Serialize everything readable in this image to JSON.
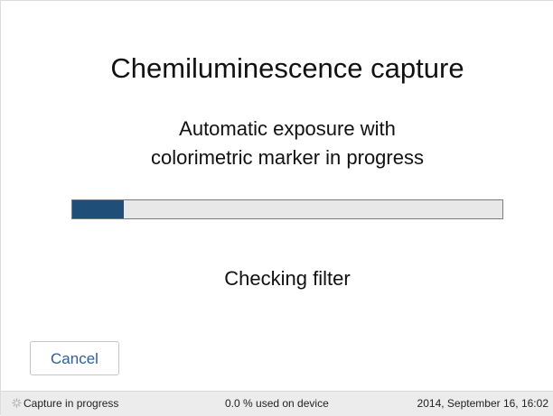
{
  "dialog": {
    "title": "Chemiluminescence capture",
    "subtitle_line1": "Automatic exposure with",
    "subtitle_line2": "colorimetric marker in progress",
    "progress_fraction": 0.12,
    "progress_color": "#1f4e79",
    "status": "Checking filter",
    "cancel_label": "Cancel"
  },
  "statusbar": {
    "icon": "spinner-icon",
    "left_text": "Capture in progress",
    "storage_text": "0.0 % used on device",
    "datetime": "2014, September 16, 16:02"
  }
}
